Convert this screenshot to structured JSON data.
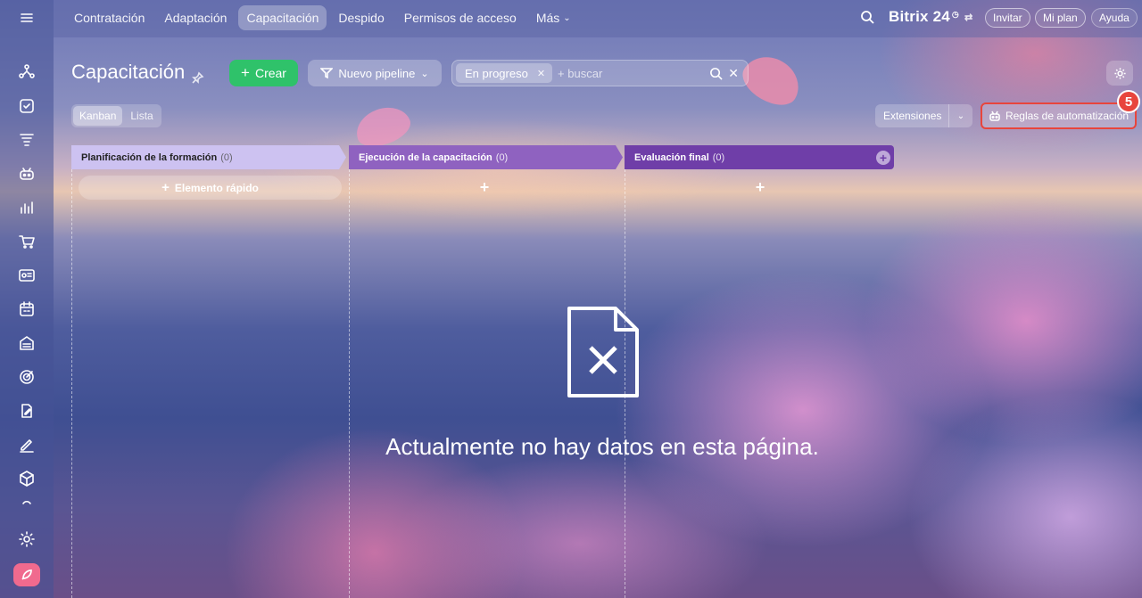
{
  "topbar": {
    "nav": [
      {
        "label": "Contratación",
        "active": false
      },
      {
        "label": "Adaptación",
        "active": false
      },
      {
        "label": "Capacitación",
        "active": true
      },
      {
        "label": "Despido",
        "active": false
      },
      {
        "label": "Permisos de acceso",
        "active": false
      },
      {
        "label": "Más",
        "active": false
      }
    ],
    "brand": "Bitrix 24",
    "invite_label": "Invitar",
    "plan_label": "Mi plan",
    "help_label": "Ayuda"
  },
  "toolbar": {
    "title": "Capacitación",
    "create_label": "Crear",
    "pipeline_label": "Nuevo pipeline",
    "filter_tag": "En progreso",
    "search_placeholder": "+ buscar"
  },
  "views": {
    "kanban": "Kanban",
    "list": "Lista",
    "active": "Kanban"
  },
  "extensions_label": "Extensiones",
  "automation_label": "Reglas de automatización",
  "annotation_badge": "5",
  "kanban": {
    "columns": [
      {
        "title": "Planificación de la formación",
        "count": "(0)",
        "color": "#cdc2f1"
      },
      {
        "title": "Ejecución de la capacitación",
        "count": "(0)",
        "color": "#8f62c0"
      },
      {
        "title": "Evaluación final",
        "count": "(0)",
        "color": "#6f3ea8"
      }
    ],
    "quick_add_label": "Elemento rápido"
  },
  "empty_state": {
    "message": "Actualmente no hay datos en esta página.",
    "icon": "file-x-icon"
  },
  "colors": {
    "create": "#2fc26a",
    "highlight": "#e8453c",
    "rocket": "#f06a8e"
  }
}
